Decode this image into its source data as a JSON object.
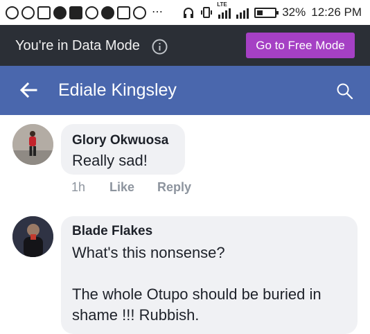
{
  "status_bar": {
    "battery": "32%",
    "time": "12:26 PM",
    "network": "LTE",
    "overflow": "⋯"
  },
  "data_banner": {
    "text": "You're in Data Mode",
    "button_label": "Go to Free Mode",
    "info_icon": "info-icon"
  },
  "header": {
    "title": "Ediale Kingsley",
    "back_icon": "back-arrow-icon",
    "search_icon": "search-icon"
  },
  "comments": [
    {
      "author": "Glory Okwuosa",
      "text": "Really sad!",
      "time": "1h",
      "like_label": "Like",
      "reply_label": "Reply"
    },
    {
      "author": "Blade Flakes",
      "text_line1": "What's this nonsense?",
      "text_line2": "The whole Otupo should be buried in",
      "text_line3": "shame !!! Rubbish."
    }
  ],
  "colors": {
    "header_bg": "#4a67ad",
    "banner_bg": "#2b2f36",
    "button_bg": "#a540c4",
    "bubble_bg": "#f0f1f4"
  }
}
